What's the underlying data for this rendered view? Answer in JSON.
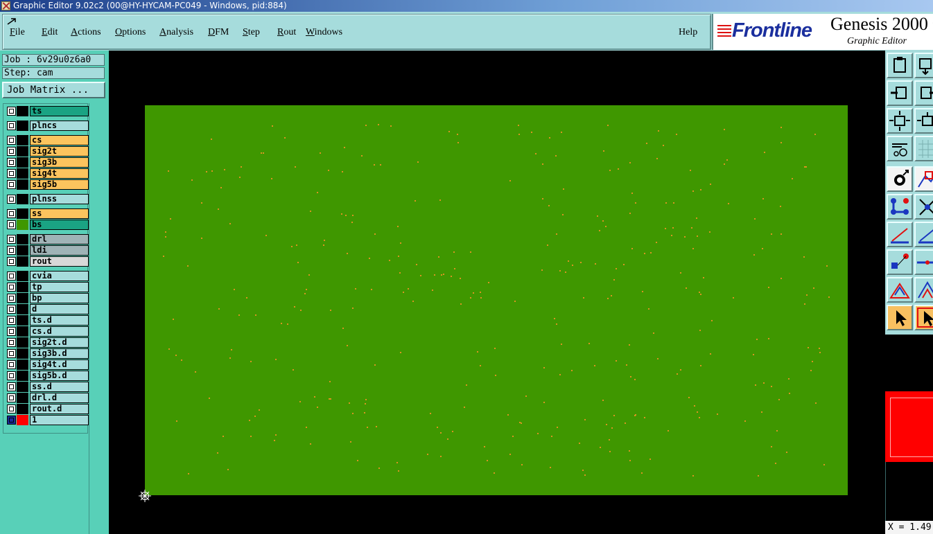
{
  "window": {
    "title": "Graphic Editor 9.02c2 (00@HY-HYCAM-PC049 - Windows, pid:884)"
  },
  "menu": {
    "items": [
      {
        "label": "File"
      },
      {
        "label": "Edit"
      },
      {
        "label": "Actions"
      },
      {
        "label": "Options"
      },
      {
        "label": "Analysis"
      },
      {
        "label": "DFM"
      },
      {
        "label": "Step"
      },
      {
        "label": "Rout"
      },
      {
        "label": "Windows"
      }
    ],
    "help": "Help"
  },
  "brand": {
    "logo": "Frontline",
    "product": "Genesis 2000",
    "product_sup": "2",
    "subtitle": "Graphic Editor"
  },
  "job": {
    "job_text": "Job : 6v29u0z6a0",
    "step_text": "Step: cam",
    "matrix_button": "Job Matrix ..."
  },
  "layers": [
    {
      "name": "ts",
      "color": "#1aa383"
    },
    {
      "name": "plncs",
      "color": "#a6dcdc"
    },
    {
      "name": "cs",
      "color": "#fcc45e"
    },
    {
      "name": "sig2t",
      "color": "#fcc45e"
    },
    {
      "name": "sig3b",
      "color": "#fcc45e"
    },
    {
      "name": "sig4t",
      "color": "#fcc45e"
    },
    {
      "name": "sig5b",
      "color": "#fcc45e"
    },
    {
      "name": "plnss",
      "color": "#a6dcdc"
    },
    {
      "name": "ss",
      "color": "#fcc45e"
    },
    {
      "name": "bs",
      "color": "#1aa383",
      "swatch": "#3f9700"
    },
    {
      "name": "drl",
      "color": "#9fb3b6"
    },
    {
      "name": "ldi",
      "color": "#9fb3b6"
    },
    {
      "name": "rout",
      "color": "#d8d8d8"
    },
    {
      "name": "cvia",
      "color": "#a6dcdc"
    },
    {
      "name": "tp",
      "color": "#a6dcdc"
    },
    {
      "name": "bp",
      "color": "#a6dcdc"
    },
    {
      "name": "d",
      "color": "#a6dcdc"
    },
    {
      "name": "ts.d",
      "color": "#a6dcdc"
    },
    {
      "name": "cs.d",
      "color": "#a6dcdc"
    },
    {
      "name": "sig2t.d",
      "color": "#a6dcdc"
    },
    {
      "name": "sig3b.d",
      "color": "#a6dcdc"
    },
    {
      "name": "sig4t.d",
      "color": "#a6dcdc"
    },
    {
      "name": "sig5b.d",
      "color": "#a6dcdc"
    },
    {
      "name": "ss.d",
      "color": "#a6dcdc"
    },
    {
      "name": "drl.d",
      "color": "#a6dcdc"
    },
    {
      "name": "rout.d",
      "color": "#a6dcdc"
    },
    {
      "name": "1",
      "color": "#a6dcdc",
      "swatch": "#ff0000",
      "active": true
    }
  ],
  "status": {
    "x_readout": "X = 1.49"
  },
  "colors": {
    "board": "#3f9700",
    "pad": "#d99520",
    "panel": "#a6dcdc",
    "accent": "#58d0b8"
  }
}
